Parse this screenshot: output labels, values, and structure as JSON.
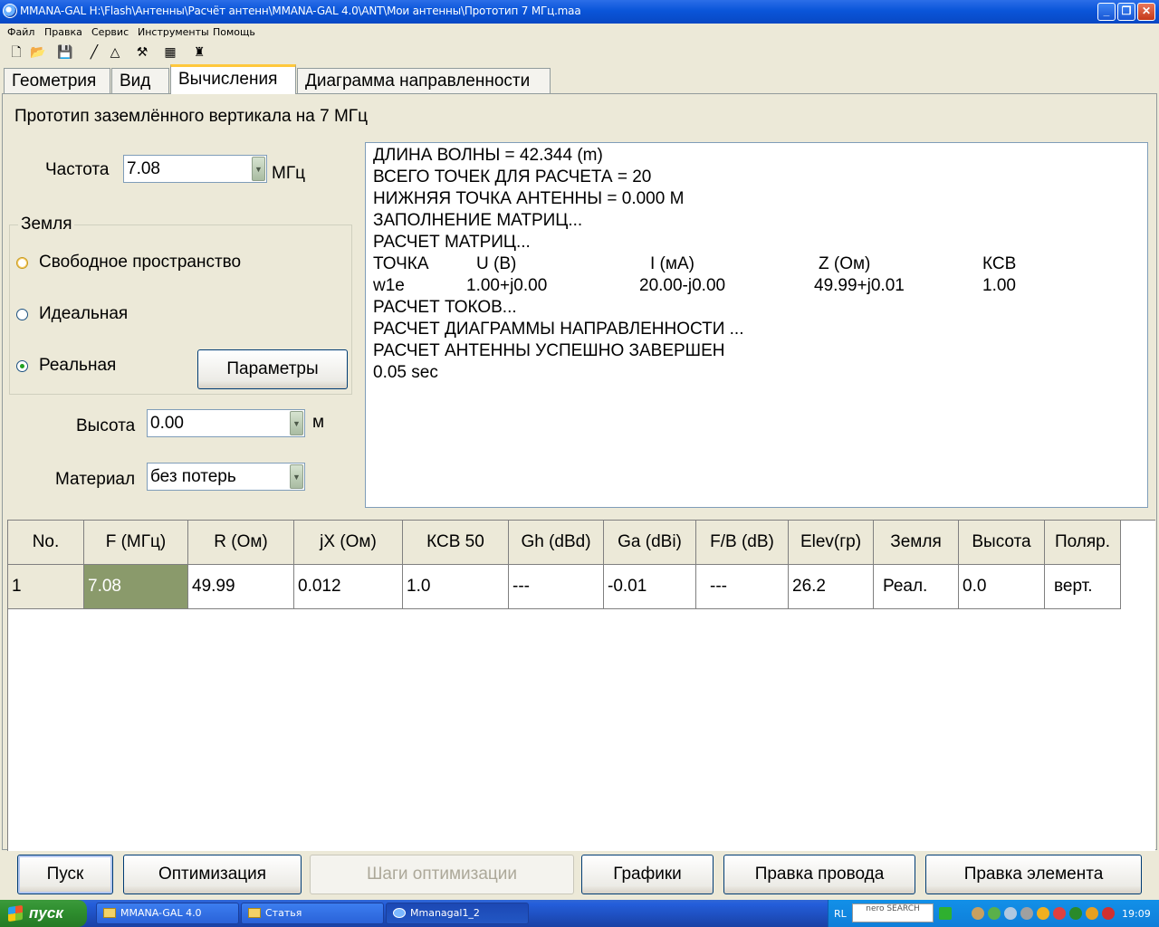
{
  "window": {
    "title": "MMANA-GAL H:\\Flash\\Антенны\\Расчёт антенн\\MMANA-GAL 4.0\\ANT\\Мои антенны\\Прототип 7 МГц.maa",
    "minimize": "_",
    "maximize": "❐",
    "close": "✕"
  },
  "menu": [
    "Файл",
    "Правка",
    "Сервис",
    "Инструменты",
    "Помощь"
  ],
  "tabs": [
    "Геометрия",
    "Вид",
    "Вычисления",
    "Диаграмма направленности"
  ],
  "heading": "Прототип заземлённого вертикала на 7 МГц",
  "frequency": {
    "label": "Частота",
    "value": "7.08",
    "unit": "МГц"
  },
  "ground": {
    "title": "Земля",
    "options": [
      "Свободное пространство",
      "Идеальная",
      "Реальная"
    ],
    "params_button": "Параметры"
  },
  "height": {
    "label": "Высота",
    "value": "0.00",
    "unit": "м"
  },
  "material": {
    "label": "Материал",
    "value": "без потерь"
  },
  "output": {
    "lines": [
      "ДЛИНА ВОЛНЫ = 42.344 (m)",
      "ВСЕГО ТОЧЕК ДЛЯ РАСЧЕТА = 20",
      "НИЖНЯЯ ТОЧКА АНТЕННЫ = 0.000 М",
      "ЗАПОЛНЕНИЕ МАТРИЦ...",
      "РАСЧЕТ МАТРИЦ..."
    ],
    "table_header": [
      "ТОЧКА",
      "U (В)",
      "I (мА)",
      "Z (Ом)",
      "КСВ"
    ],
    "table_row": [
      "w1e",
      "1.00+j0.00",
      "20.00-j0.00",
      "49.99+j0.01",
      "1.00"
    ],
    "lines_after": [
      "РАСЧЕТ ТОКОВ...",
      "РАСЧЕТ ДИАГРАММЫ НАПРАВЛЕННОСТИ ...",
      "РАСЧЕТ АНТЕННЫ УСПЕШНО ЗАВЕРШЕН",
      "0.05 sec"
    ]
  },
  "grid": {
    "headers": [
      "No.",
      "F (МГц)",
      "R (Ом)",
      "jX (Ом)",
      "КСВ 50",
      "Gh (dBd)",
      "Ga (dBi)",
      "F/B (dB)",
      "Elev(гр)",
      "Земля",
      "Высота",
      "Поляр."
    ],
    "rows": [
      [
        "1",
        "7.08",
        "49.99",
        "0.012",
        "1.0",
        "---",
        "-0.01",
        "---",
        "26.2",
        "Реал.",
        "0.0",
        "верт."
      ]
    ],
    "selected_color": "#8a9a6b"
  },
  "buttons": {
    "start": "Пуск",
    "optimize": "Оптимизация",
    "opt_steps": "Шаги оптимизации",
    "graphs": "Графики",
    "edit_wire": "Правка провода",
    "edit_element": "Правка элемента"
  },
  "taskbar": {
    "start": "пуск",
    "items": [
      "MMANA-GAL 4.0",
      "Статья",
      "Mmanagal1_2"
    ],
    "lang": "RL",
    "nero": "nero SEARCH",
    "clock": "19:09"
  }
}
